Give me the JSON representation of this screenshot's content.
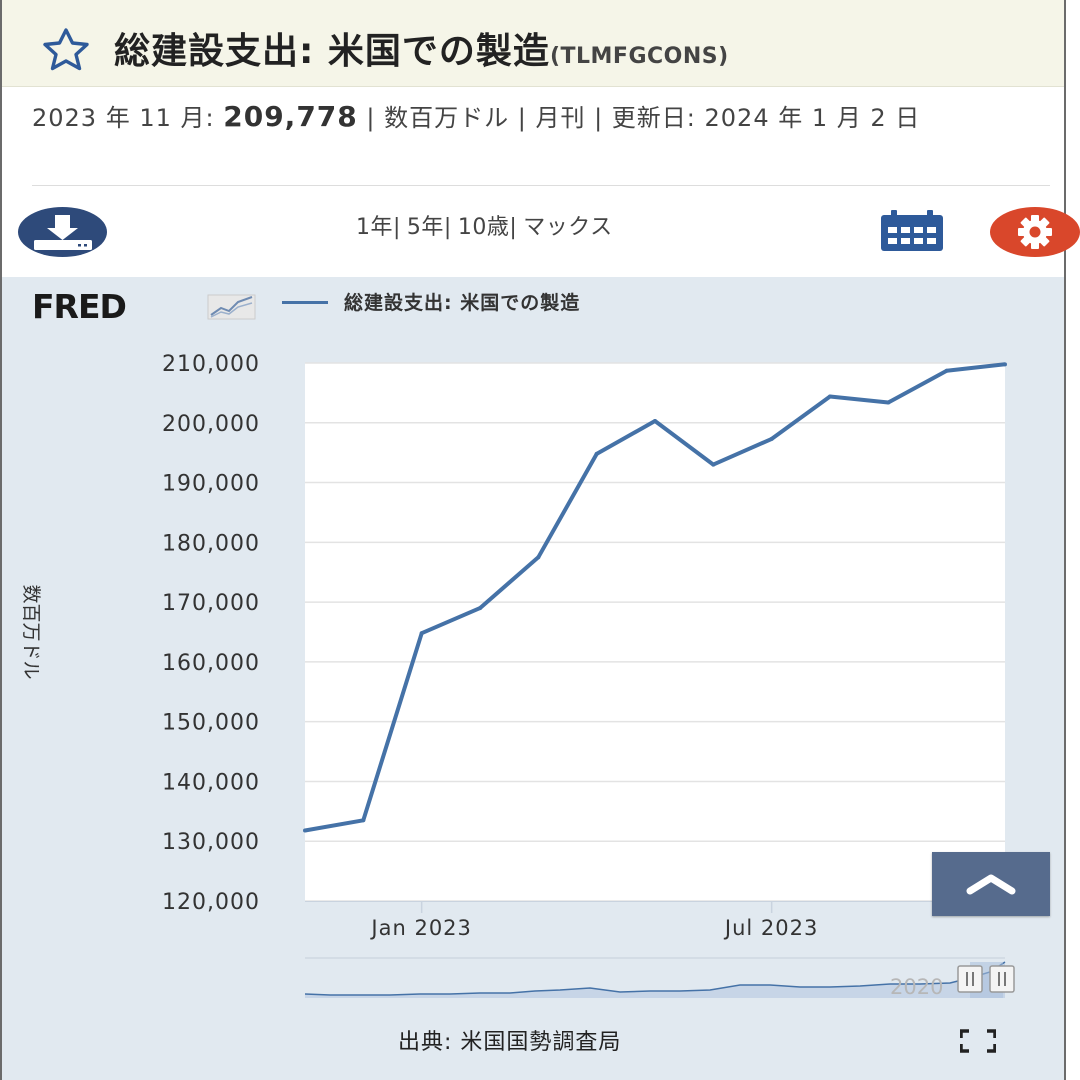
{
  "header": {
    "title": "総建設支出: 米国での製造",
    "code": "(TLMFGCONS)"
  },
  "meta": {
    "date": "2023 年 11 月:",
    "value": "209,778",
    "rest": "| 数百万ドル | 月刊 | 更新日: 2024 年 1 月 2 日"
  },
  "toolbar": {
    "ranges": [
      "1年",
      "5年",
      "10歳",
      "マックス"
    ],
    "download_icon": "download-icon",
    "calendar_icon": "calendar-icon",
    "settings_icon": "gear-icon",
    "settings_color": "#d9472b",
    "accent": "#2e4a7a"
  },
  "logo": {
    "text": "FRED"
  },
  "source": "出典: 米国国勢調査局",
  "chart_data": {
    "type": "line",
    "title": "",
    "ylabel": "数百万ドル",
    "xlabel": "",
    "ylim": [
      120000,
      210000
    ],
    "yticks": [
      120000,
      130000,
      140000,
      150000,
      160000,
      170000,
      180000,
      190000,
      200000,
      210000
    ],
    "ytick_labels": [
      "120,000",
      "130,000",
      "140,000",
      "150,000",
      "160,000",
      "170,000",
      "180,000",
      "190,000",
      "200,000",
      "210,000"
    ],
    "xlim": [
      "2022-11",
      "2023-11"
    ],
    "xticks": [
      {
        "x": "2023-01",
        "label": "Jan 2023"
      },
      {
        "x": "2023-07",
        "label": "Jul 2023"
      }
    ],
    "series": [
      {
        "name": "総建設支出: 米国での製造",
        "color": "#4572a7",
        "x": [
          "2022-11",
          "2022-12",
          "2023-01",
          "2023-02",
          "2023-03",
          "2023-04",
          "2023-05",
          "2023-06",
          "2023-07",
          "2023-08",
          "2023-09",
          "2023-10",
          "2023-11"
        ],
        "values": [
          131800,
          133500,
          164800,
          169000,
          177500,
          194800,
          200300,
          193000,
          197300,
          204400,
          203400,
          208700,
          209778
        ]
      }
    ],
    "grid": true,
    "legend": "top-left",
    "navigator_label": "2020"
  }
}
